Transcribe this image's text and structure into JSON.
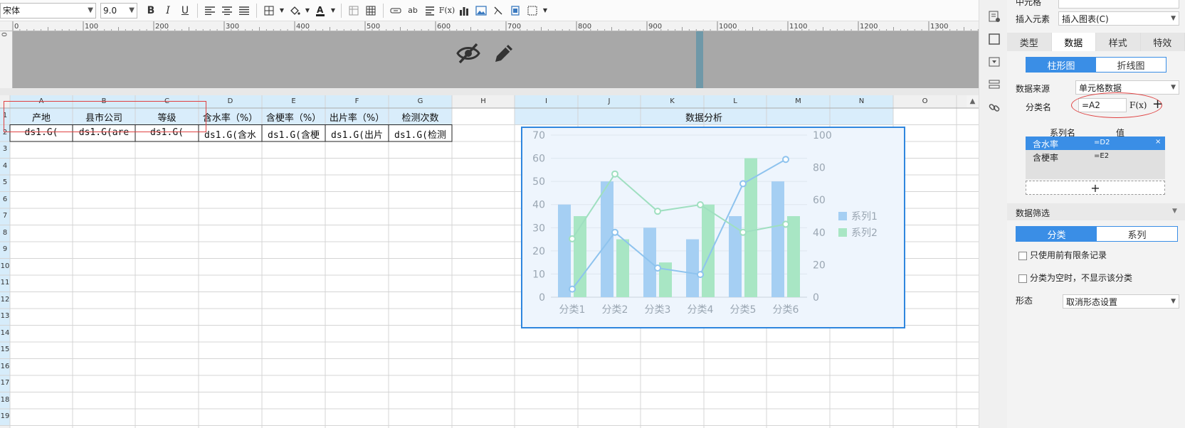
{
  "toolbar": {
    "font_name": "宋体",
    "font_size": "9.0",
    "bold_label": "B",
    "italic_label": "I",
    "underline_label": "U",
    "fx_label": "F(x)",
    "ab_label": "ab"
  },
  "ruler": {
    "ticks": [
      "0",
      "100",
      "200",
      "300",
      "400",
      "500",
      "600",
      "700",
      "800",
      "900",
      "1000",
      "1100",
      "1200",
      "1300"
    ],
    "vertical_start": "0"
  },
  "sheet": {
    "columns": [
      "A",
      "B",
      "C",
      "D",
      "E",
      "F",
      "G",
      "H",
      "I",
      "J",
      "K",
      "L",
      "M",
      "N",
      "O"
    ],
    "rows": [
      "1",
      "2",
      "3",
      "4",
      "5",
      "6",
      "7",
      "8",
      "9",
      "10",
      "11",
      "12",
      "13",
      "14",
      "15",
      "16",
      "17",
      "18",
      "19"
    ],
    "header_cells": [
      "产地",
      "县市公司",
      "等级",
      "含水率（%）",
      "含梗率（%）",
      "出片率（%）",
      "检测次数"
    ],
    "data_cells": [
      "ds1.G(",
      "ds1.G(are",
      "ds1.G(",
      "ds1.G(含水",
      "ds1.G(含梗",
      "ds1.G(出片",
      "ds1.G(检测"
    ],
    "merged_title": "数据分析"
  },
  "chart_data": {
    "type": "bar",
    "categories": [
      "分类1",
      "分类2",
      "分类3",
      "分类4",
      "分类5",
      "分类6"
    ],
    "series": [
      {
        "name": "系列1",
        "values": [
          40,
          50,
          30,
          25,
          35,
          50
        ],
        "color": "#a5cff3"
      },
      {
        "name": "系列2",
        "values": [
          35,
          25,
          15,
          40,
          60,
          35
        ],
        "color": "#a8e6c4"
      }
    ],
    "line_series": [
      {
        "name": "系列1",
        "values": [
          5,
          40,
          18,
          14,
          70,
          85
        ],
        "color": "#8ec3ee"
      },
      {
        "name": "系列2",
        "values": [
          36,
          76,
          53,
          57,
          40,
          45
        ],
        "color": "#9fdfc0"
      }
    ],
    "ylim_left": [
      0,
      70
    ],
    "yticks_left": [
      "0",
      "10",
      "20",
      "30",
      "40",
      "50",
      "60",
      "70"
    ],
    "ylim_right": [
      0,
      100
    ],
    "yticks_right": [
      "0",
      "20",
      "40",
      "60",
      "80",
      "100"
    ],
    "legend": "right",
    "grid": true
  },
  "panel": {
    "top_label": "中元格",
    "insert_label": "插入元素",
    "insert_value": "插入图表(C)",
    "tabs": [
      "类型",
      "数据",
      "样式",
      "特效"
    ],
    "active_tab": "数据",
    "chart_kind_tabs": [
      "柱形图",
      "折线图"
    ],
    "data_source_label": "数据来源",
    "data_source_value": "单元格数据",
    "category_label": "分类名",
    "category_value": "=A2",
    "fx_label": "F(x)",
    "add_label": "+",
    "series_header_name": "系列名",
    "series_header_value": "值",
    "series_rows": [
      {
        "name": "含水率",
        "value": "=D2"
      },
      {
        "name": "含梗率",
        "value": "=E2"
      }
    ],
    "series_add": "+",
    "filter_title": "数据筛选",
    "filter_tabs": [
      "分类",
      "系列"
    ],
    "check1": "只使用前有限条记录",
    "check2": "分类为空时，不显示该分类",
    "shape_label": "形态",
    "shape_value": "取消形态设置"
  }
}
